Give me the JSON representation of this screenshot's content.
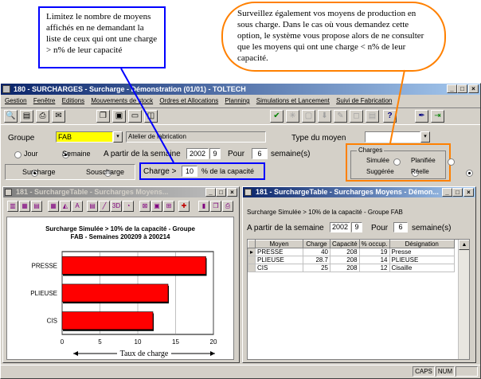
{
  "callouts": {
    "left": "Limitez le nombre de moyens affichés en ne demandant la liste de ceux qui ont une charge > n% de leur capacité",
    "right": "Surveillez également vos moyens de production en sous charge. Dans le cas où vous demandez cette option, le système  vous propose alors de ne consulter que les moyens qui ont une charge < n% de leur capacité."
  },
  "main_window": {
    "title": "180 - SURCHARGES - Surcharge - Démonstration (01/01) - TOLTECH",
    "menu": [
      "Gestion",
      "Fenêtre",
      "Editions",
      "Mouvements de stock",
      "Ordres et Allocations",
      "Planning",
      "Simulations et Lancement",
      "Suivi de Fabrication"
    ],
    "form": {
      "groupe_label": "Groupe",
      "groupe_value": "FAB",
      "groupe_desc": "Atelier de fabrication",
      "type_moyen_label": "Type du moyen",
      "type_moyen_value": "",
      "period_options": [
        "Jour",
        "Semaine"
      ],
      "period_selected": "Semaine",
      "from_week_label": "A partir de la semaine",
      "year": "2002",
      "week": "9",
      "pour_label": "Pour",
      "pour_value": "6",
      "semaines_label": "semaine(s)",
      "mode_options": [
        "Surcharge",
        "Souscharge"
      ],
      "mode_selected": "Surcharge",
      "charge_label": "Charge >",
      "charge_value": "10",
      "charge_unit": "% de la capacité",
      "charges_group": "Charges",
      "charges_options": [
        "Simulée",
        "Planifiée",
        "Suggérée",
        "Réelle"
      ],
      "charges_selected": "Réelle"
    }
  },
  "chart_window": {
    "title": "181 - SurchargeTable - Surcharges Moyens...",
    "chart_data": {
      "type": "bar",
      "orientation": "horizontal",
      "title": "Surcharge Simulée > 10% de la capacité - Groupe FAB - Semaines 200209 à 200214",
      "categories": [
        "PRESSE",
        "PLIEUSE",
        "CIS"
      ],
      "values": [
        19,
        14,
        12
      ],
      "xlim": [
        0,
        20
      ],
      "xticks": [
        "0",
        "5",
        "10",
        "15",
        "20"
      ],
      "xlabel": "Taux de charge",
      "color": "#ff0000"
    }
  },
  "table_window": {
    "title": "181 - SurchargeTable - Surcharges Moyens - Démon...",
    "subtitle": "Surcharge Simulée > 10% de la capacité - Groupe FAB",
    "from_week_label": "A partir de la semaine",
    "year": "2002",
    "week": "9",
    "pour_label": "Pour",
    "pour_value": "6",
    "semaines_label": "semaine(s)",
    "columns": [
      "Moyen",
      "Charge",
      "Capacité",
      "% occup.",
      "Désignation"
    ],
    "rows": [
      [
        "PRESSE",
        "40",
        "208",
        "19",
        "Presse"
      ],
      [
        "PLIEUSE",
        "28.7",
        "208",
        "14",
        "PLIEUSE"
      ],
      [
        "CIS",
        "25",
        "208",
        "12",
        "Cisaille"
      ]
    ]
  },
  "statusbar": {
    "caps": "CAPS",
    "num": "NUM"
  },
  "colors": {
    "highlight_blue": "#0000ff",
    "highlight_orange": "#ff8000",
    "groupe_field": "#ffff00"
  }
}
